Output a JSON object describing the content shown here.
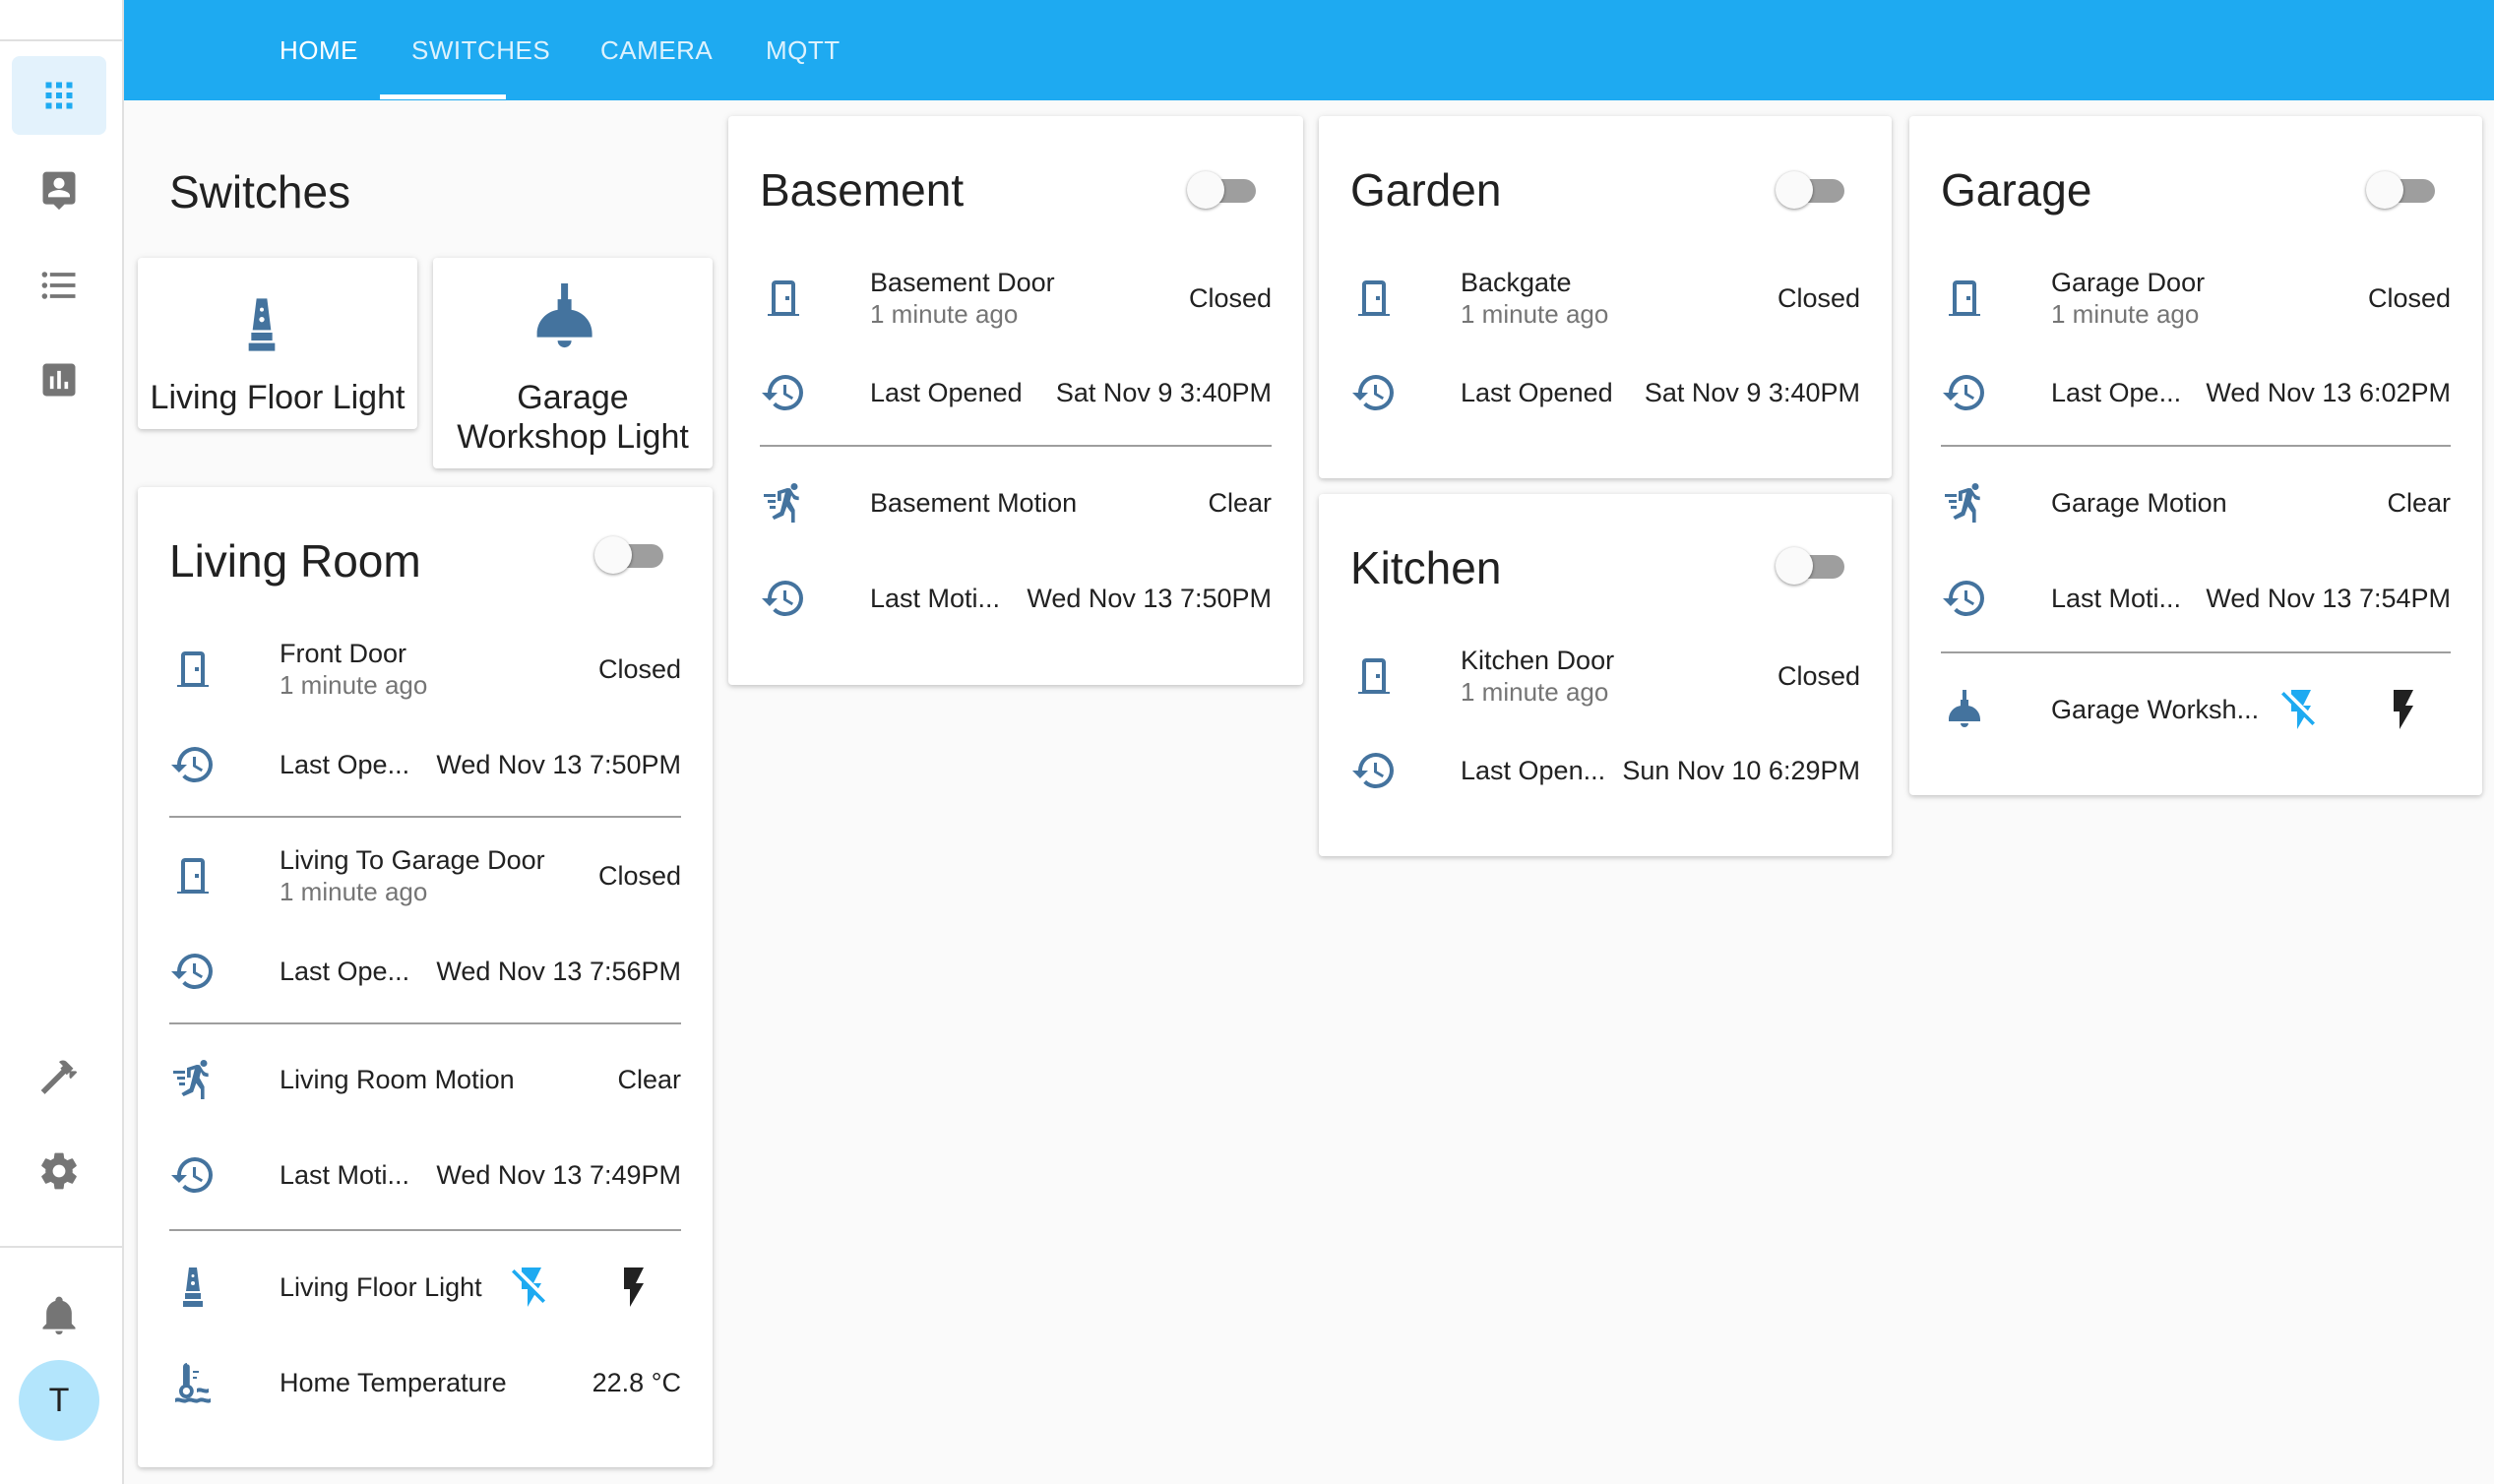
{
  "colors": {
    "header": "#1eaaf1",
    "icon": "#44739e",
    "active_icon": "#1eaaf1",
    "toggle_off": "#9e9e9e",
    "avatar": "#b3e5fc"
  },
  "sidebar": {
    "items": [
      {
        "icon": "overview-grid-icon"
      },
      {
        "icon": "map-person-icon"
      },
      {
        "icon": "logbook-list-icon"
      },
      {
        "icon": "history-chart-icon"
      },
      {
        "icon": "developer-tools-hammer-icon"
      },
      {
        "icon": "configuration-gear-icon"
      },
      {
        "icon": "notifications-bell-icon"
      }
    ],
    "avatar_initial": "T"
  },
  "header": {
    "tabs": [
      {
        "label": "HOME",
        "active": true
      },
      {
        "label": "SWITCHES",
        "active": false
      },
      {
        "label": "CAMERA",
        "active": false
      },
      {
        "label": "MQTT",
        "active": false
      }
    ]
  },
  "switches": {
    "title": "Switches",
    "buttons": [
      {
        "label": "Living Floor Light",
        "icon": "floor-lamp-icon"
      },
      {
        "label": "Garage Workshop Light",
        "icon": "ceiling-light-icon"
      }
    ]
  },
  "living_room": {
    "title": "Living Room",
    "toggle_on": false,
    "rows": [
      {
        "name": "Front Door",
        "sub": "1 minute ago",
        "state": "Closed",
        "icon": "door-icon"
      },
      {
        "name": "Last Ope...",
        "state": "Wed Nov 13 7:50PM",
        "icon": "history-icon"
      },
      {
        "name": "Living To Garage Door",
        "sub": "1 minute ago",
        "state": "Closed",
        "icon": "door-icon"
      },
      {
        "name": "Last Ope...",
        "state": "Wed Nov 13 7:56PM",
        "icon": "history-icon"
      },
      {
        "name": "Living Room Motion",
        "state": "Clear",
        "icon": "motion-run-icon"
      },
      {
        "name": "Last Moti...",
        "state": "Wed Nov 13 7:49PM",
        "icon": "history-icon"
      },
      {
        "name": "Living Floor Light",
        "icon": "floor-lamp-icon"
      },
      {
        "name": "Home Temperature",
        "state": "22.8 °C",
        "icon": "thermometer-icon"
      }
    ]
  },
  "basement": {
    "title": "Basement",
    "toggle_on": false,
    "rows": [
      {
        "name": "Basement Door",
        "sub": "1 minute ago",
        "state": "Closed",
        "icon": "door-icon"
      },
      {
        "name": "Last Opened",
        "state": "Sat Nov 9 3:40PM",
        "icon": "history-icon"
      },
      {
        "name": "Basement Motion",
        "state": "Clear",
        "icon": "motion-run-icon"
      },
      {
        "name": "Last Moti...",
        "state": "Wed Nov 13 7:50PM",
        "icon": "history-icon"
      }
    ]
  },
  "garden": {
    "title": "Garden",
    "toggle_on": false,
    "rows": [
      {
        "name": "Backgate",
        "sub": "1 minute ago",
        "state": "Closed",
        "icon": "door-icon"
      },
      {
        "name": "Last Opened",
        "state": "Sat Nov 9 3:40PM",
        "icon": "history-icon"
      }
    ]
  },
  "kitchen": {
    "title": "Kitchen",
    "toggle_on": false,
    "rows": [
      {
        "name": "Kitchen Door",
        "sub": "1 minute ago",
        "state": "Closed",
        "icon": "door-icon"
      },
      {
        "name": "Last Open...",
        "state": "Sun Nov 10 6:29PM",
        "icon": "history-icon"
      }
    ]
  },
  "garage": {
    "title": "Garage",
    "toggle_on": false,
    "rows": [
      {
        "name": "Garage Door",
        "sub": "1 minute ago",
        "state": "Closed",
        "icon": "door-icon"
      },
      {
        "name": "Last Ope...",
        "state": "Wed Nov 13 6:02PM",
        "icon": "history-icon"
      },
      {
        "name": "Garage Motion",
        "state": "Clear",
        "icon": "motion-run-icon"
      },
      {
        "name": "Last Moti...",
        "state": "Wed Nov 13 7:54PM",
        "icon": "history-icon"
      },
      {
        "name": "Garage Worksh...",
        "icon": "ceiling-light-icon"
      }
    ]
  },
  "light_controls": {
    "off_icon": "flash-off-icon",
    "on_icon": "flash-on-icon"
  }
}
